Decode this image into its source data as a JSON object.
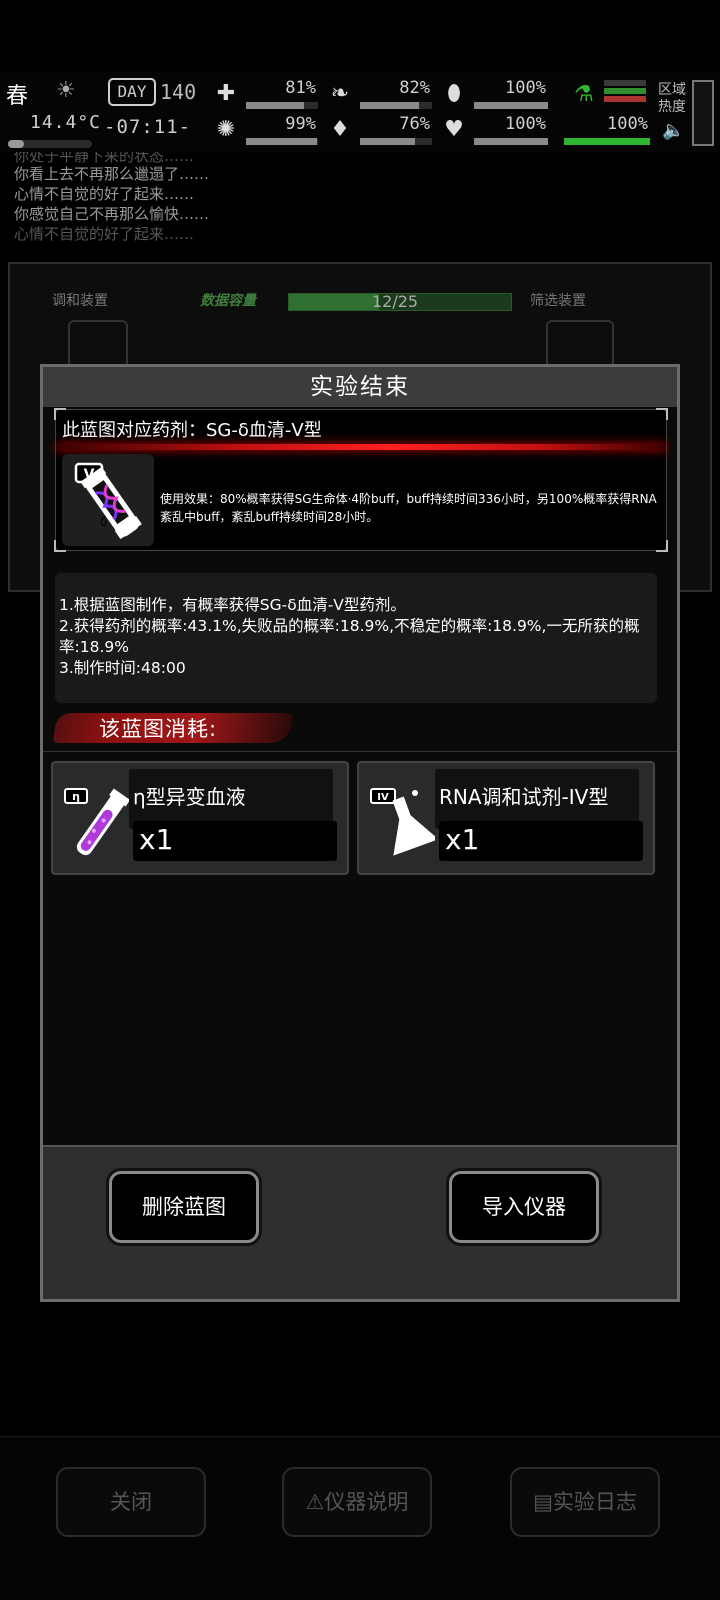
{
  "status": {
    "season": "春",
    "temperature": "14.4°C",
    "day_label": "DAY",
    "day_number": "140",
    "clock": "-07:11-",
    "stats": [
      {
        "icon": "medkit-icon",
        "glyph": "✚",
        "percent": "81%",
        "value": 81
      },
      {
        "icon": "stomach-icon",
        "glyph": "❧",
        "percent": "82%",
        "value": 82
      },
      {
        "icon": "pill-icon",
        "glyph": "⬮",
        "percent": "100%",
        "value": 100
      },
      {
        "icon": "brain-icon",
        "glyph": "✺",
        "percent": "99%",
        "value": 99
      },
      {
        "icon": "water-drop-icon",
        "glyph": "💧",
        "percent": "76%",
        "value": 76
      },
      {
        "icon": "heart-icon",
        "glyph": "♥",
        "percent": "100%",
        "value": 100
      },
      {
        "icon": "flask-icon",
        "glyph": "⚗",
        "percent": "100%",
        "value": 100
      }
    ],
    "region_heat_label": "区域热度"
  },
  "log": [
    "你处于平静下来的状态……",
    "你看上去不再那么邋遢了……",
    "心情不自觉的好了起来……",
    "你感觉自己不再那么愉快……",
    "心情不自觉的好了起来……"
  ],
  "lab": {
    "left_device": "调和装置",
    "capacity_label": "数据容量",
    "capacity": "12/25",
    "right_device": "筛选装置"
  },
  "modal": {
    "title": "实验结束",
    "blueprint_header": "此蓝图对应药剂：SG-δ血清-V型",
    "blueprint_desc": "使用效果：80%概率获得SG生命体·4阶buff，buff持续时间336小时，另100%概率获得RNA紊乱中buff，紊乱buff持续时间28小时。",
    "info_lines": [
      "1.根据蓝图制作，有概率获得SG-δ血清-V型药剂。",
      "2.获得药剂的概率:43.1%,失败品的概率:18.9%,不稳定的概率:18.9%,一无所获的概率:18.9%",
      "3.制作时间:48:00"
    ],
    "consume_title": "该蓝图消耗:",
    "materials": [
      {
        "name": "η型异变血液",
        "qty": "x1",
        "badge": "η"
      },
      {
        "name": "RNA调和试剂-IV型",
        "qty": "x1",
        "badge": "IV"
      }
    ],
    "delete_button": "删除蓝图",
    "import_button": "导入仪器"
  },
  "bottom": {
    "close_button": "关闭",
    "manual_button": "仪器说明",
    "log_button": "实验日志"
  }
}
